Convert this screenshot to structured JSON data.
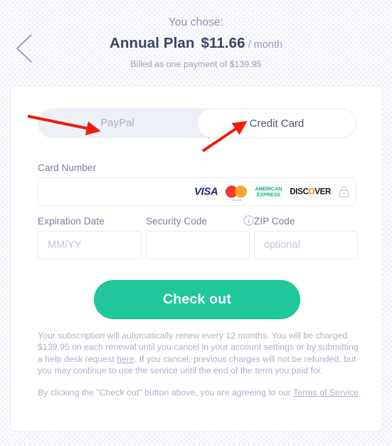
{
  "header": {
    "you_chose": "You chose:",
    "plan_name": "Annual Plan",
    "price": "$11.66",
    "period": "/ month",
    "billed_note": "Billed as one payment of $139.95",
    "back_icon": "chevron-left-icon"
  },
  "payment_toggle": {
    "options": [
      {
        "label": "PayPal",
        "active": false
      },
      {
        "label": "Credit Card",
        "active": true
      }
    ]
  },
  "form": {
    "card_number": {
      "label": "Card Number",
      "value": "",
      "placeholder": ""
    },
    "expiration": {
      "label": "Expiration Date",
      "value": "",
      "placeholder": "MM/YY"
    },
    "security_code": {
      "label": "Security Code",
      "value": "",
      "placeholder": "",
      "info_icon": "info-circle-icon"
    },
    "zip_code": {
      "label": "ZIP Code",
      "value": "",
      "placeholder": "optional"
    },
    "brands": [
      {
        "name": "visa-logo",
        "text": "VISA"
      },
      {
        "name": "mastercard-logo",
        "text": "mastercard"
      },
      {
        "name": "american-express-logo",
        "line1": "AMERICAN",
        "line2": "EXPRESS"
      },
      {
        "name": "discover-logo",
        "text": "DISCOVER"
      },
      {
        "name": "lock-icon",
        "text": ""
      }
    ]
  },
  "checkout": {
    "label": "Check out"
  },
  "fine_print": {
    "paragraph1_part1": "Your subscription will automatically renew every 12 months. You will be charged $139.95 on each renewal until you cancel in your account settings or by submitting a help desk request ",
    "paragraph1_link": "here",
    "paragraph1_part2": ". If you cancel, previous charges will not be refunded, but you may continue to use the service until the end of the term you paid for.",
    "paragraph2_part1": "By clicking the \"Check out\" button above, you are agreeing to our ",
    "paragraph2_link": "Terms of Service",
    "paragraph2_part2": "."
  },
  "colors": {
    "accent_button": "#1fc79b",
    "heading": "#3d4463",
    "muted_text": "#aab0ca",
    "toggle_track": "#eef0f8",
    "annotation_arrow": "#f01c0a",
    "visa": "#1b2d6b",
    "amex": "#1aaf8b",
    "discover_o": "#f58220"
  },
  "annotations": {
    "arrow_paypal": "red-arrow-pointing-to-paypal",
    "arrow_credit_card": "red-arrow-pointing-to-credit-card"
  }
}
